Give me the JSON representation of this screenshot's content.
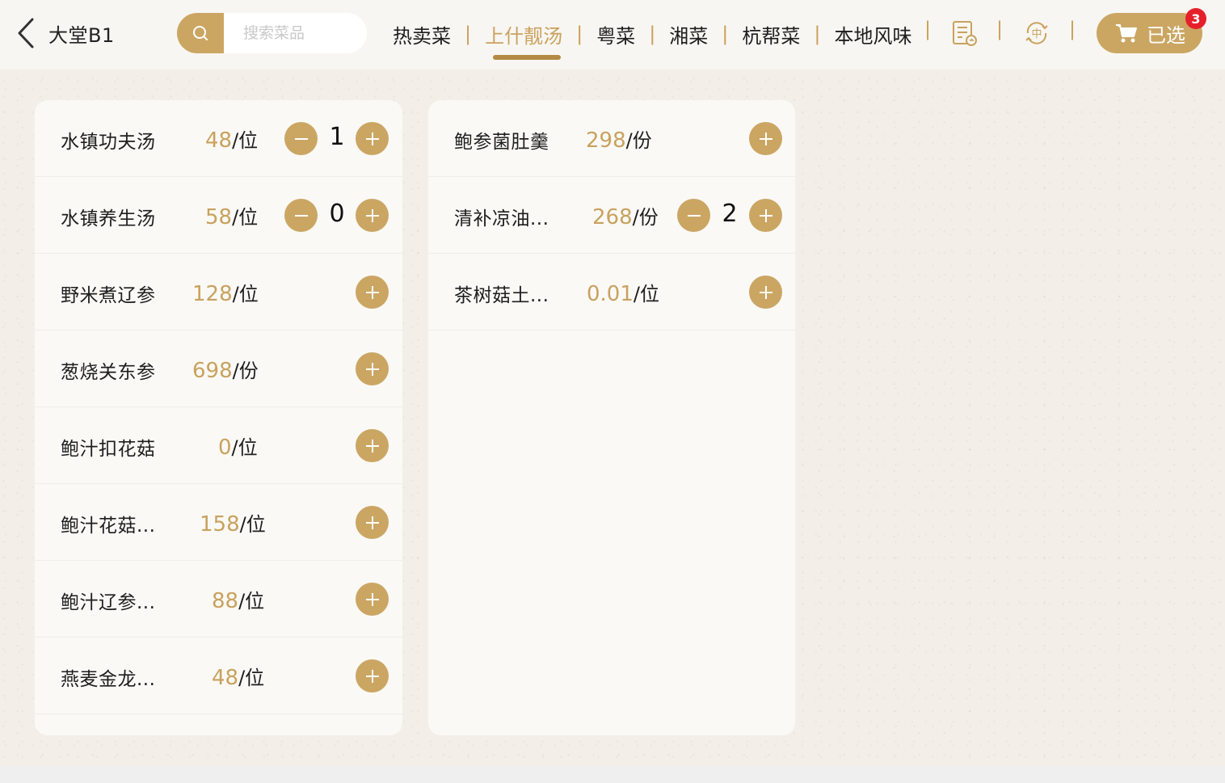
{
  "header": {
    "back_label": "大堂B1",
    "search_placeholder": "搜索菜品",
    "tabs": [
      {
        "label": "热卖菜"
      },
      {
        "label": "上什靓汤"
      },
      {
        "label": "粤菜"
      },
      {
        "label": "湘菜"
      },
      {
        "label": "杭帮菜"
      },
      {
        "label": "本地风味"
      }
    ],
    "active_tab": "上什靓汤",
    "cart_label": "已选",
    "cart_count": "3",
    "icons": [
      "order-list-icon",
      "language-switch-icon",
      "cart-icon"
    ]
  },
  "colors": {
    "accent": "#cba663",
    "accent_text": "#c9a25e",
    "badge": "#e6202a",
    "background": "#f3efe8"
  },
  "left_list": [
    {
      "name": "水镇功夫汤",
      "price": "48",
      "unit": "/位",
      "qty": "1"
    },
    {
      "name": "水镇养生汤",
      "price": "58",
      "unit": "/位",
      "qty": "0"
    },
    {
      "name": "野米煮辽参",
      "price": "128",
      "unit": "/位"
    },
    {
      "name": "葱烧关东参",
      "price": "698",
      "unit": "/份"
    },
    {
      "name": "鲍汁扣花菇",
      "price": "0",
      "unit": "/位"
    },
    {
      "name": "鲍汁花菇...",
      "price": "158",
      "unit": "/位"
    },
    {
      "name": "鲍汁辽参...",
      "price": "88",
      "unit": "/位"
    },
    {
      "name": "燕麦金龙...",
      "price": "48",
      "unit": "/位"
    }
  ],
  "right_list": [
    {
      "name": "鲍参菌肚羹",
      "price": "298",
      "unit": "/份"
    },
    {
      "name": "清补凉油...",
      "price": "268",
      "unit": "/份",
      "qty": "2"
    },
    {
      "name": "茶树菇土...",
      "price": "0.01",
      "unit": "/位"
    }
  ]
}
